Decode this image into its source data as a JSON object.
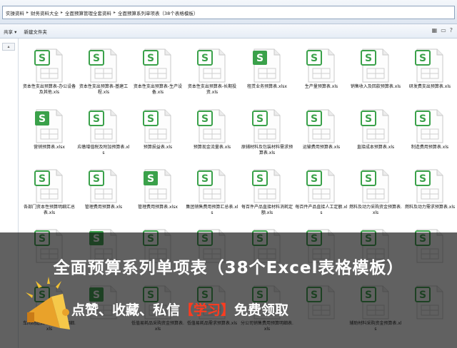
{
  "address": {
    "crumbs": [
      "实操资料",
      "财务资料大全",
      "全面预算管理全套资料",
      "全面预算系列单项表（38个表格模板）"
    ]
  },
  "toolbar": {
    "share": "共享 ▾",
    "new_folder": "新建文件夹"
  },
  "files": [
    [
      "资本性支出预算表-办公设备及其他.xls",
      "资本性支出预算表-基建工程.xls",
      "资本性支出预算表-生产设备.xls",
      "资本性支出预算表-长期投资.xls",
      "租赁业务预算表.xlsx",
      "生产量预算表.xls",
      "销售收入及回款预算表.xls",
      "研发费支出预算表.xls"
    ],
    [
      "营销预算表.xlsx",
      "应缴增值税及附加预算表.xls",
      "预算损益表.xls",
      "预算现金流量表.xls",
      "原辅材料及包装材料需求预算表.xls",
      "运输费用预算表.xls",
      "直接成本预算表.xls",
      "制造费用预算表.xls"
    ],
    [
      "各部门资本性预算明细汇总表.xls",
      "管理费用预算表.xls",
      "管理费用预算表.xlsx",
      "集团销售费用预算汇总表.xls",
      "每百件产品直接材料消耗定额.xls",
      "每百件产品直接人工定额.xls",
      "燃料及动力采购资金预算表.xls",
      "燃料及动力需求预算表.xls"
    ],
    [
      "",
      "",
      "",
      "",
      "",
      "",
      "",
      ""
    ],
    [
      "车间制造费用分配表及明细.xls",
      "",
      "低值易耗品采购资金预算表.xls",
      "低值易耗品需求预算表.xls",
      "分公司销售费用预算明细表.xls",
      "",
      "辅助材料采购资金预算表.xls",
      ""
    ]
  ],
  "highlight": [
    [
      4
    ],
    [
      0
    ],
    [
      2
    ],
    [
      1
    ],
    [
      1
    ]
  ],
  "banner": {
    "title": "全面预算系列单项表（38个Excel表格模板）",
    "cta_prefix": "点赞、收藏、私信",
    "cta_red": "【学习】",
    "cta_suffix": "免费领取"
  },
  "colors": {
    "icon_green": "#3aa14a",
    "cta_red": "#ff3b1f"
  }
}
